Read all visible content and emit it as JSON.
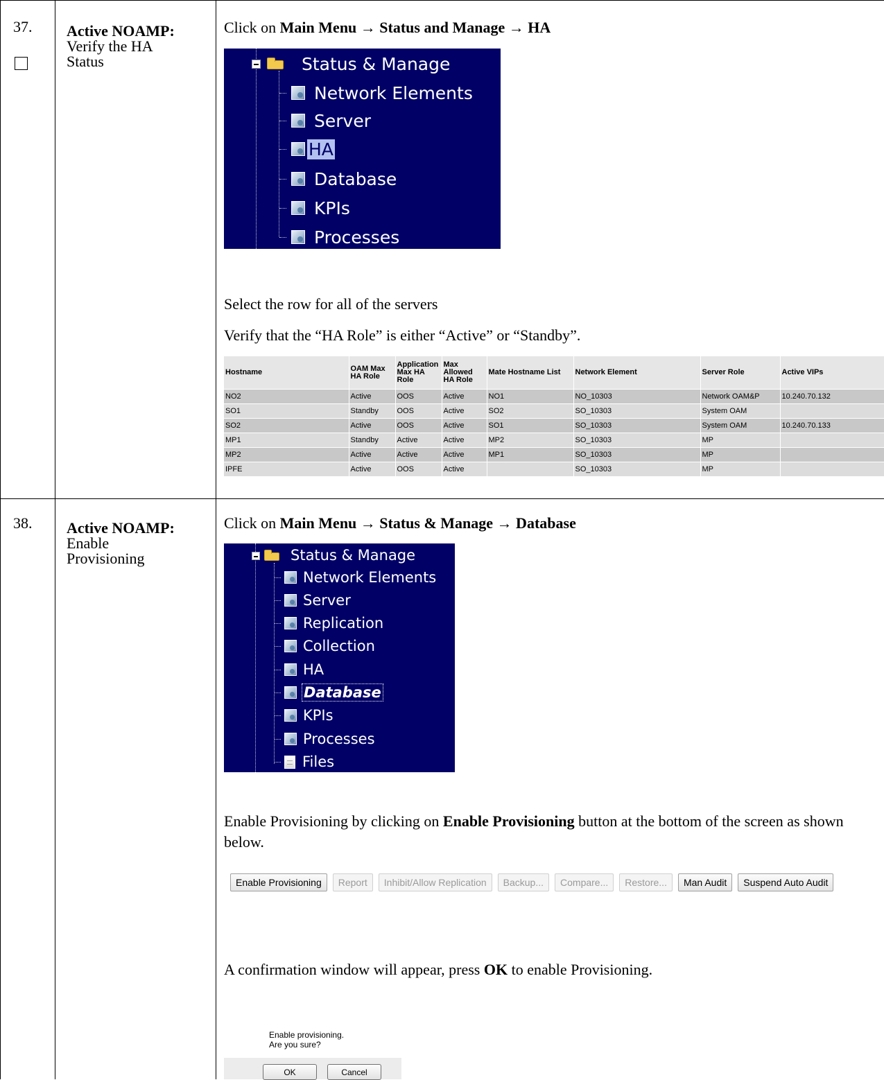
{
  "step37": {
    "number": "37.",
    "title_bold": "Active NOAMP:",
    "title_rest": "Verify the HA Status",
    "instruction_prefix": "Click on ",
    "instruction_path": "Main Menu → Status and Manage → HA",
    "menu": {
      "root": "Status & Manage",
      "items": [
        "Network Elements",
        "Server",
        "HA",
        "Database",
        "KPIs",
        "Processes"
      ],
      "selected": "HA"
    },
    "select_text": "Select the row for all of the servers",
    "verify_text": "Verify that the “HA Role” is either “Active” or “Standby”.",
    "table": {
      "headers": [
        "Hostname",
        "OAM Max HA Role",
        "Application Max HA Role",
        "Max Allowed HA Role",
        "Mate Hostname List",
        "Network Element",
        "Server Role",
        "Active VIPs"
      ],
      "rows": [
        [
          "NO2",
          "Active",
          "OOS",
          "Active",
          "NO1",
          "NO_10303",
          "Network OAM&P",
          "10.240.70.132"
        ],
        [
          "SO1",
          "Standby",
          "OOS",
          "Active",
          "SO2",
          "SO_10303",
          "System OAM",
          ""
        ],
        [
          "SO2",
          "Active",
          "OOS",
          "Active",
          "SO1",
          "SO_10303",
          "System OAM",
          "10.240.70.133"
        ],
        [
          "MP1",
          "Standby",
          "Active",
          "Active",
          "MP2",
          "SO_10303",
          "MP",
          ""
        ],
        [
          "MP2",
          "Active",
          "Active",
          "Active",
          "MP1",
          "SO_10303",
          "MP",
          ""
        ],
        [
          "IPFE",
          "Active",
          "OOS",
          "Active",
          "",
          "SO_10303",
          "MP",
          ""
        ]
      ]
    }
  },
  "step38": {
    "number": "38.",
    "title_bold": "Active NOAMP:",
    "title_rest": "Enable Provisioning",
    "instruction_prefix": "Click on ",
    "instruction_path": "Main Menu → Status & Manage → Database",
    "menu": {
      "root": "Status & Manage",
      "items": [
        "Network Elements",
        "Server",
        "Replication",
        "Collection",
        "HA",
        "Database",
        "KPIs",
        "Processes",
        "Files"
      ],
      "selected": "Database"
    },
    "enable_text_1": "Enable Provisioning by clicking on ",
    "enable_text_bold": "Enable Provisioning",
    "enable_text_2": " button at the bottom of the screen as shown below.",
    "buttons": [
      {
        "label": "Enable Provisioning",
        "enabled": true
      },
      {
        "label": "Report",
        "enabled": false
      },
      {
        "label": "Inhibit/Allow Replication",
        "enabled": false
      },
      {
        "label": "Backup...",
        "enabled": false
      },
      {
        "label": "Compare...",
        "enabled": false
      },
      {
        "label": "Restore...",
        "enabled": false
      },
      {
        "label": "Man Audit",
        "enabled": true
      },
      {
        "label": "Suspend Auto Audit",
        "enabled": true
      }
    ],
    "confirm_text_1": "A confirmation window will appear, press ",
    "confirm_text_bold": "OK",
    "confirm_text_2": " to enable Provisioning.",
    "dialog": {
      "message": "Enable provisioning.\nAre you sure?",
      "ok": "OK",
      "cancel": "Cancel"
    }
  }
}
